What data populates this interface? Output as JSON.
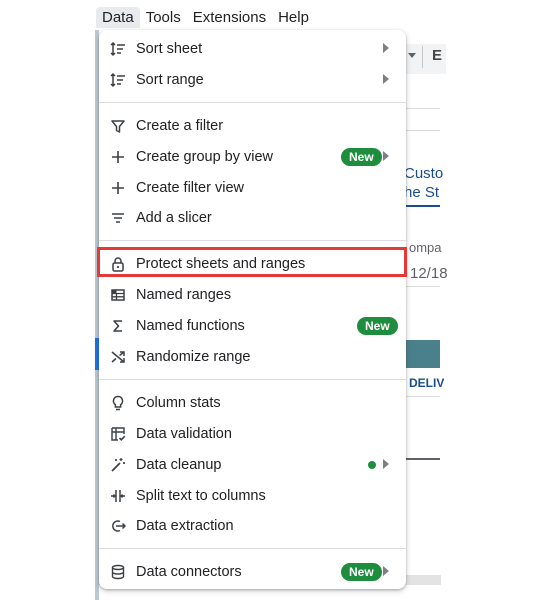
{
  "menubar": {
    "items": [
      {
        "label": "Data",
        "active": true
      },
      {
        "label": "Tools"
      },
      {
        "label": "Extensions"
      },
      {
        "label": "Help"
      }
    ]
  },
  "background": {
    "toolbar_letter": "E",
    "heading_line1": "Custo",
    "heading_line2": "he St",
    "label_compa": "ompa",
    "date_fragment": "12/18",
    "column_header": "DELIV"
  },
  "menu": {
    "sections": [
      [
        {
          "label": "Sort sheet",
          "icon": "sort-icon",
          "submenu": true
        },
        {
          "label": "Sort range",
          "icon": "sort-icon",
          "submenu": true
        }
      ],
      [
        {
          "label": "Create a filter",
          "icon": "filter-icon"
        },
        {
          "label": "Create group by view",
          "icon": "plus-icon",
          "badge": "New",
          "submenu": true
        },
        {
          "label": "Create filter view",
          "icon": "plus-icon"
        },
        {
          "label": "Add a slicer",
          "icon": "slicer-icon"
        }
      ],
      [
        {
          "label": "Protect sheets and ranges",
          "icon": "lock-icon",
          "highlighted": true
        },
        {
          "label": "Named ranges",
          "icon": "named-ranges-icon"
        },
        {
          "label": "Named functions",
          "icon": "sigma-icon",
          "badge": "New"
        },
        {
          "label": "Randomize range",
          "icon": "shuffle-icon"
        }
      ],
      [
        {
          "label": "Column stats",
          "icon": "lightbulb-icon"
        },
        {
          "label": "Data validation",
          "icon": "data-validation-icon"
        },
        {
          "label": "Data cleanup",
          "icon": "magic-wand-icon",
          "dot": true,
          "submenu": true
        },
        {
          "label": "Split text to columns",
          "icon": "split-icon"
        },
        {
          "label": "Data extraction",
          "icon": "extraction-icon"
        }
      ],
      [
        {
          "label": "Data connectors",
          "icon": "database-icon",
          "badge": "New",
          "submenu": true
        }
      ]
    ]
  },
  "colors": {
    "badge_green": "#1e8e3e",
    "highlight_red": "#e53935",
    "sheet_header_teal": "#4a7f8c",
    "heading_blue": "#1a4e8a"
  }
}
